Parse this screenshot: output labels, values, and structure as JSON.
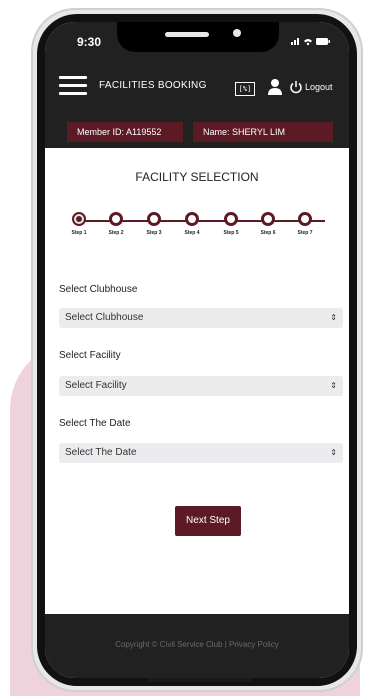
{
  "status_bar": {
    "time": "9:30",
    "icons": "signal-wifi-battery-icons"
  },
  "header": {
    "title": "FACILITIES BOOKING",
    "calc_icon_text": "[%]",
    "logout_label": "Logout",
    "member_id": "Member ID: A119552",
    "name": "Name: SHERYL LIM"
  },
  "page": {
    "section_title": "FACILITY SELECTION"
  },
  "steps": [
    "Step 1",
    "Step 2",
    "Step 3",
    "Step 4",
    "Step 5",
    "Step 6",
    "Step 7"
  ],
  "active_step": 1,
  "form": {
    "clubhouse": {
      "label": "Select Clubhouse",
      "value": "Select Clubhouse"
    },
    "facility": {
      "label": "Select Facility",
      "value": "Select Facility"
    },
    "date": {
      "label": "Select The Date",
      "value": "Select The Date"
    }
  },
  "buttons": {
    "next": "Next Step"
  },
  "footer": {
    "text": "Copyright © Civil Service Club | Privacy Policy"
  },
  "colors": {
    "accent": "#5c1b24",
    "dark": "#212121",
    "pink": "#efd3dc"
  }
}
